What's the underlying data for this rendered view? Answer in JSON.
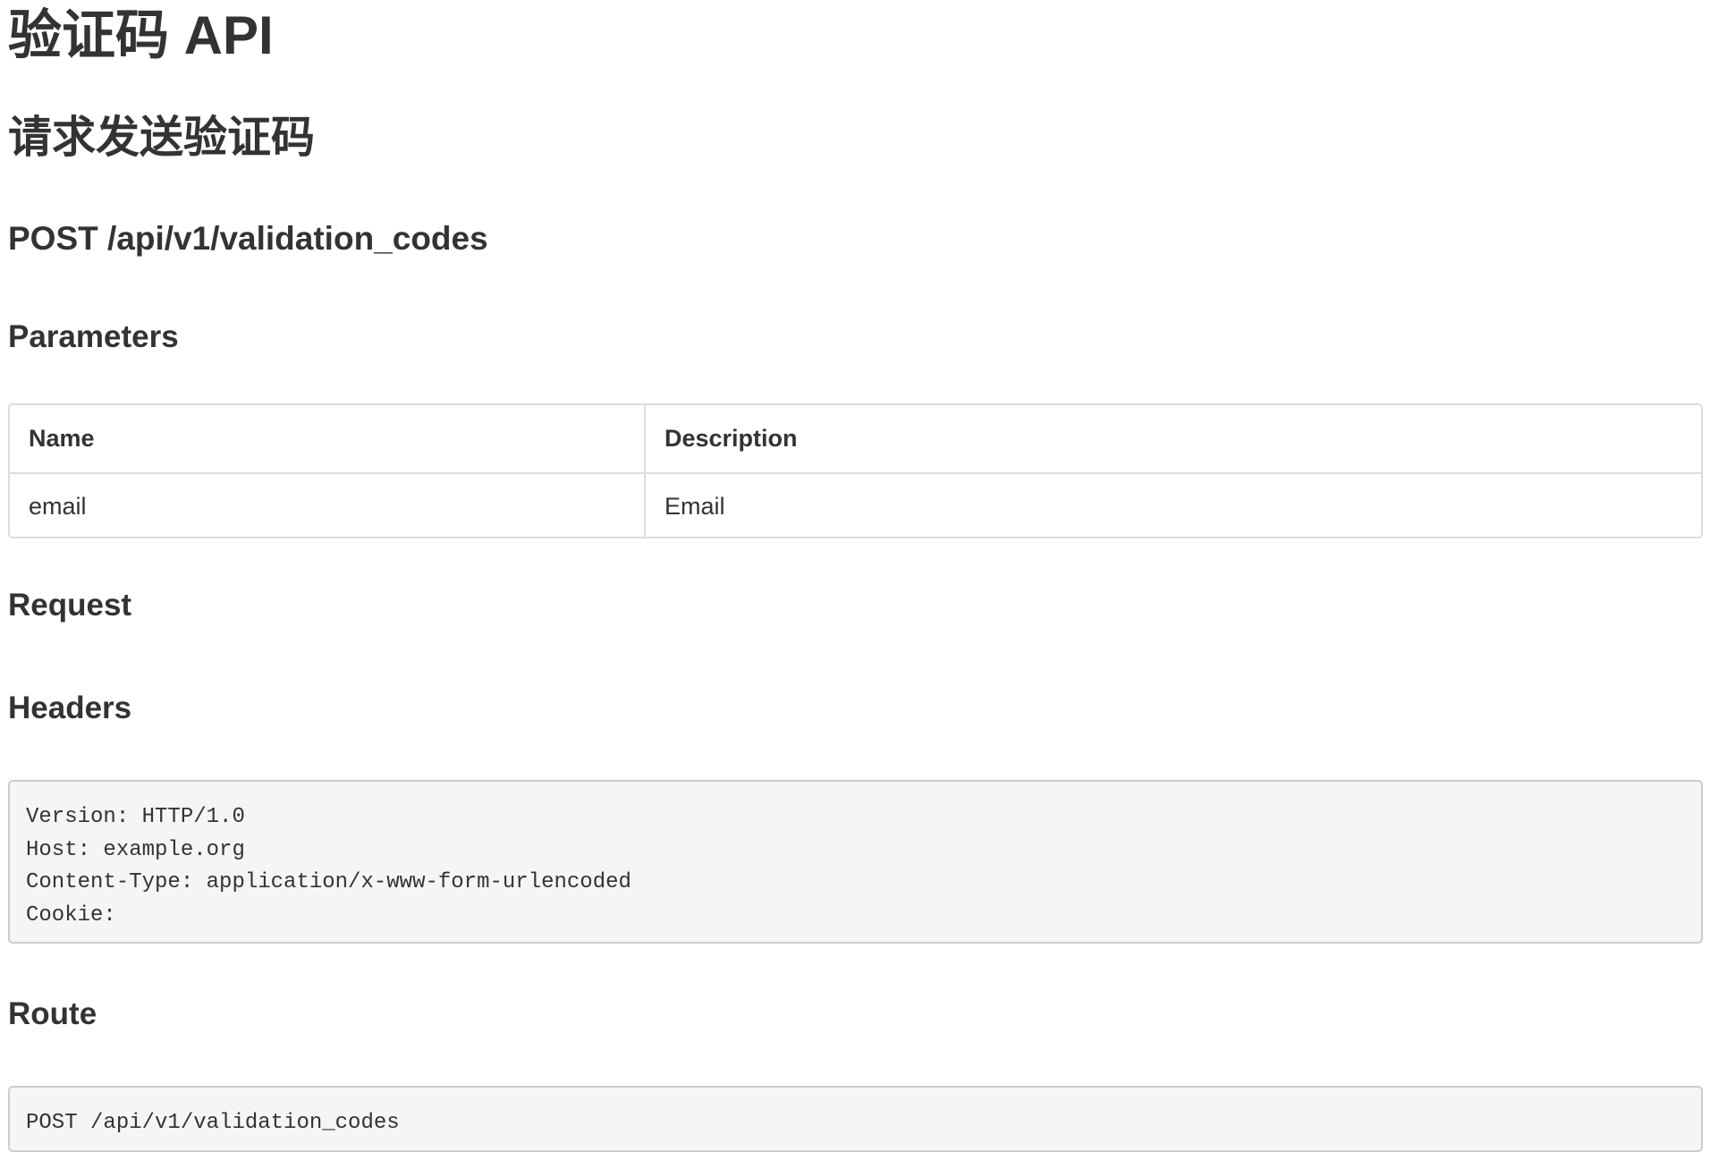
{
  "title": "验证码 API",
  "section_title": "请求发送验证码",
  "endpoint": "POST /api/v1/validation_codes",
  "parameters": {
    "heading": "Parameters",
    "columns": [
      "Name",
      "Description"
    ],
    "rows": [
      [
        "email",
        "Email"
      ]
    ]
  },
  "request": {
    "heading": "Request",
    "headers_heading": "Headers",
    "headers_lines": [
      "Version: HTTP/1.0",
      "Host: example.org",
      "Content-Type: application/x-www-form-urlencoded",
      "Cookie:"
    ],
    "route_heading": "Route",
    "route_lines": [
      "POST /api/v1/validation_codes"
    ]
  },
  "colors": {
    "text": "#333333",
    "border": "#dddddd",
    "code_background": "#f5f5f5",
    "code_border": "#cccccc"
  }
}
